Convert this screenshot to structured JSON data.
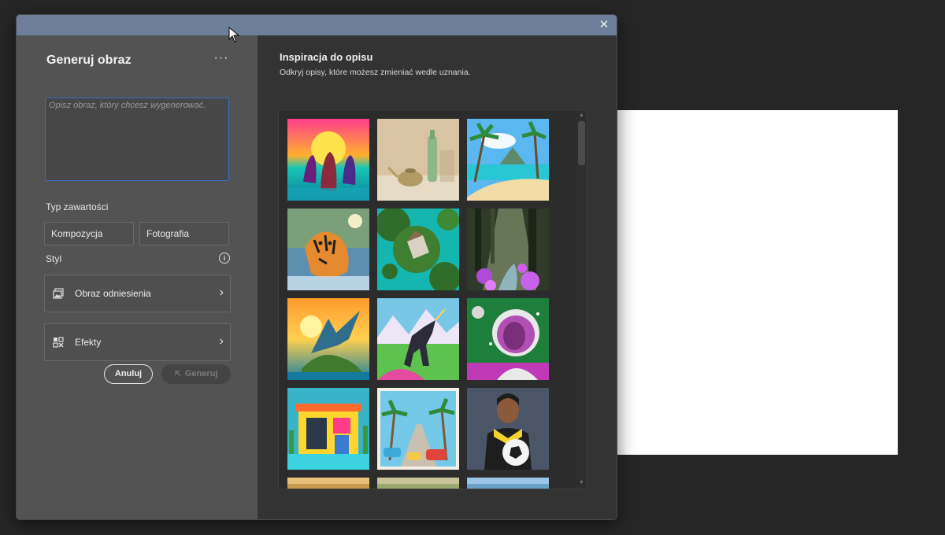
{
  "dialog": {
    "close_glyph": "✕"
  },
  "left_panel": {
    "title": "Generuj obraz",
    "more_glyph": "···",
    "prompt_placeholder": "Opisz obraz, który chcesz wygenerować.",
    "content_type_label": "Typ zawartości",
    "content_types": [
      "Kompozycja",
      "Fotografia"
    ],
    "style_label": "Styl",
    "options": [
      {
        "label": "Obraz odniesienia",
        "icon": "reference-image-icon"
      },
      {
        "label": "Efekty",
        "icon": "effects-icon"
      }
    ],
    "cancel_label": "Anuluj",
    "generate_label": "Generuj"
  },
  "right_panel": {
    "title": "Inspiracja do opisu",
    "subtitle": "Odkryj opisy, które możesz zmieniać wedle uznania.",
    "thumbnails": [
      "horses-sunset-thumbnail",
      "teapot-bottle-thumbnail",
      "tropical-beach-thumbnail",
      "tiger-river-thumbnail",
      "treehouse-island-thumbnail",
      "forest-stream-thumbnail",
      "dragon-island-thumbnail",
      "unicorn-mountains-thumbnail",
      "astronaut-portrait-thumbnail",
      "colorful-house-thumbnail",
      "palm-street-cars-thumbnail",
      "soccer-player-thumbnail"
    ]
  },
  "colors": {
    "accent_blue": "#3a70c4",
    "titlebar": "#6d7f9b"
  }
}
